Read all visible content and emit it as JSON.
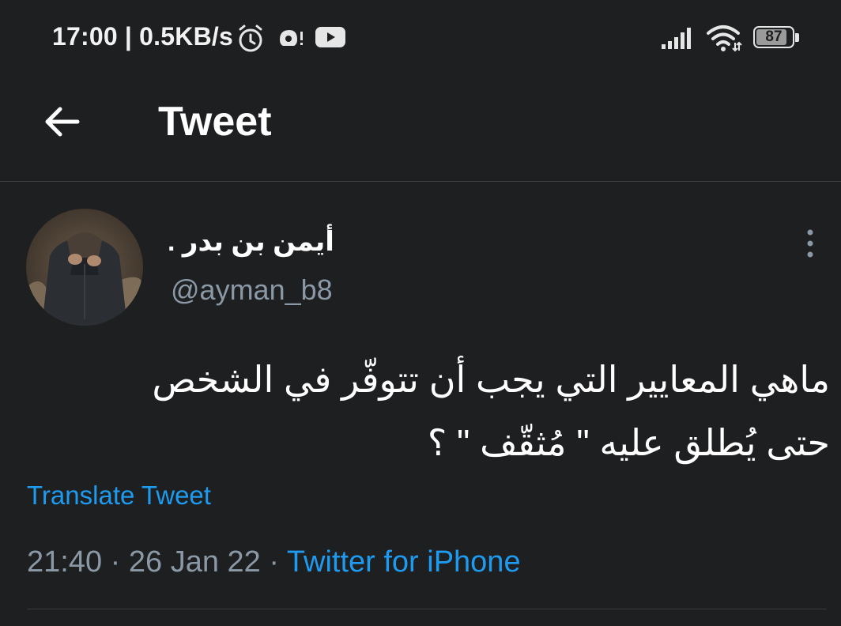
{
  "status_bar": {
    "time_speed": "17:00 | 0.5KB/s",
    "battery": "87",
    "battery_level": 0.87,
    "icons": [
      "alarm-icon",
      "mute-icon",
      "youtube-icon",
      "signal-icon",
      "wifi-icon",
      "battery-icon"
    ]
  },
  "header": {
    "title": "Tweet",
    "back_icon": "arrow-left-icon"
  },
  "tweet": {
    "display_name": "أيمن بن بدر .",
    "handle": "@ayman_b8",
    "text_line1": "ماهي المعايير التي يجب أن تتوفّر في الشخص",
    "text_line2": "حتى يُطلق عليه \" مُثقّف \" ؟",
    "translate": "Translate Tweet",
    "time": "21:40",
    "separator": "·",
    "date": "26 Jan 22",
    "source": "Twitter for iPhone"
  },
  "colors": {
    "background": "#1e1f21",
    "link": "#1d9bf0",
    "secondary_text": "#8b98a5",
    "divider": "#3a3c40"
  }
}
